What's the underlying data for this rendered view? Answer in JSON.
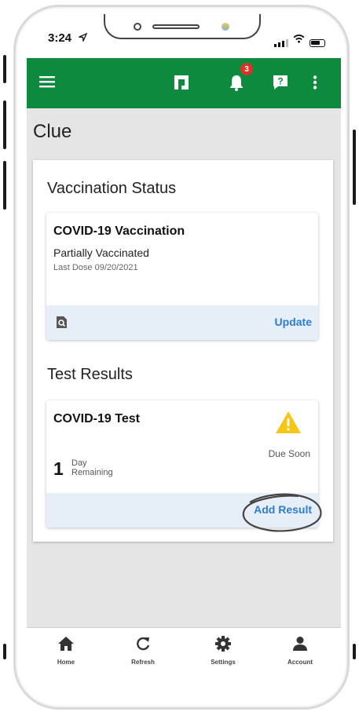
{
  "status_bar": {
    "time": "3:24"
  },
  "app_bar": {
    "notification_count": "3"
  },
  "page": {
    "title": "Clue"
  },
  "vaccination": {
    "section_title": "Vaccination Status",
    "card_title": "COVID-19 Vaccination",
    "status": "Partially Vaccinated",
    "last_dose": "Last Dose 09/20/2021",
    "action_label": "Update"
  },
  "tests": {
    "section_title": "Test Results",
    "card_title": "COVID-19 Test",
    "due_label": "Due Soon",
    "days_value": "1",
    "days_unit": "Day",
    "days_suffix": "Remaining",
    "action_label": "Add Result"
  },
  "bottom_nav": {
    "items": [
      {
        "label": "Home",
        "icon": "home-icon"
      },
      {
        "label": "Refresh",
        "icon": "refresh-icon"
      },
      {
        "label": "Settings",
        "icon": "gear-icon"
      },
      {
        "label": "Account",
        "icon": "person-icon"
      }
    ]
  },
  "colors": {
    "brand_green": "#0d8a3e",
    "badge_red": "#d8342c",
    "link_blue": "#2f7cd3",
    "warning_yellow": "#f5c518"
  }
}
